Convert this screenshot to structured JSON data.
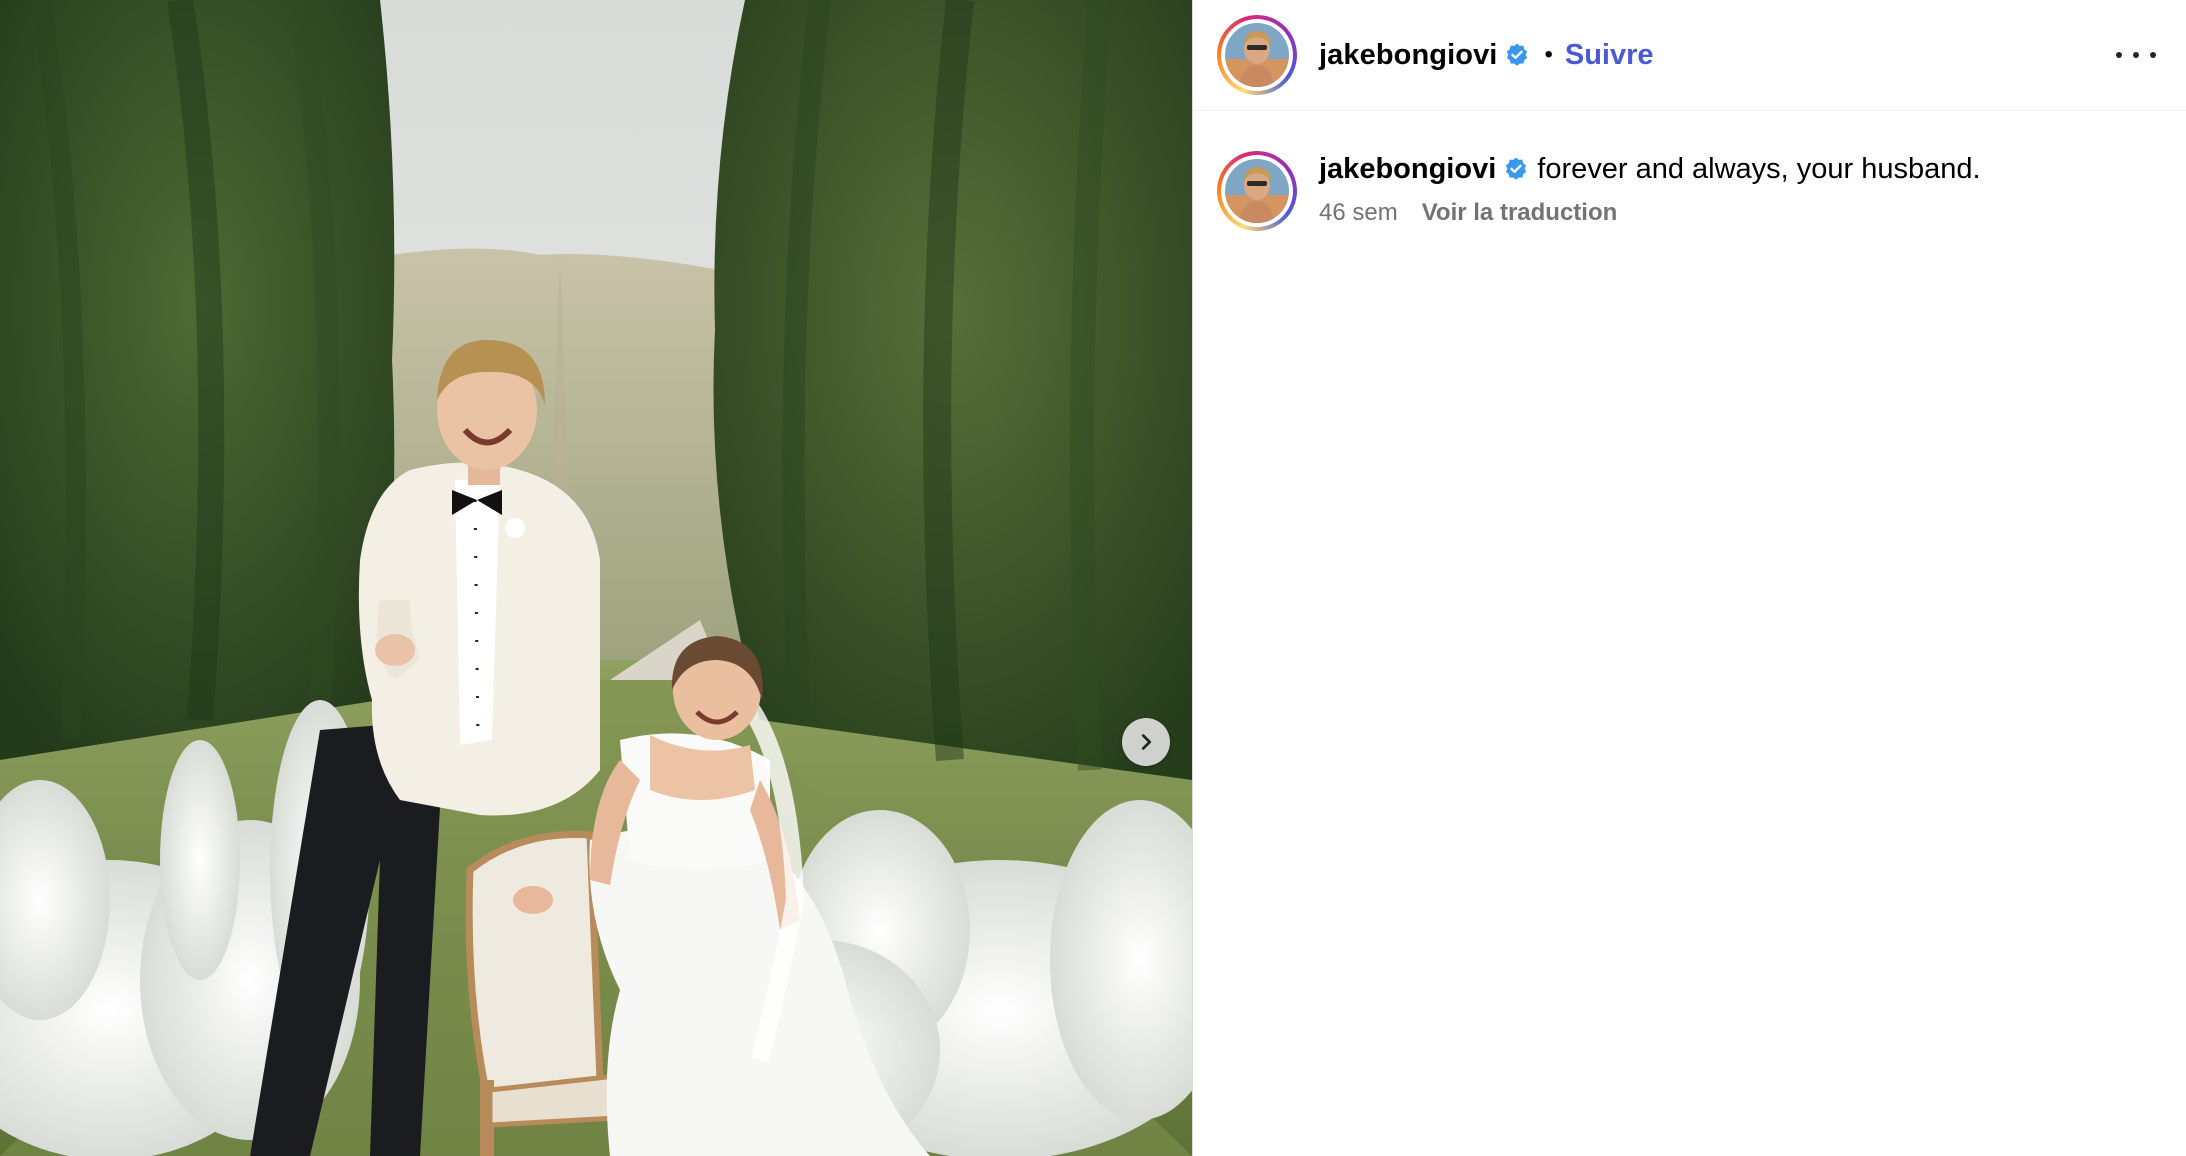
{
  "post": {
    "username": "jakebongiovi",
    "follow_label": "Suivre",
    "separator": "•",
    "caption": "forever and always, your husband.",
    "age": "46 sem",
    "translate_label": "Voir la traduction"
  },
  "icons": {
    "verified": "verified-badge-icon",
    "more": "more-options-icon",
    "next": "chevron-right-icon"
  },
  "colors": {
    "follow": "#4a5ad6",
    "verified": "#3897f0",
    "meta": "#737373"
  }
}
